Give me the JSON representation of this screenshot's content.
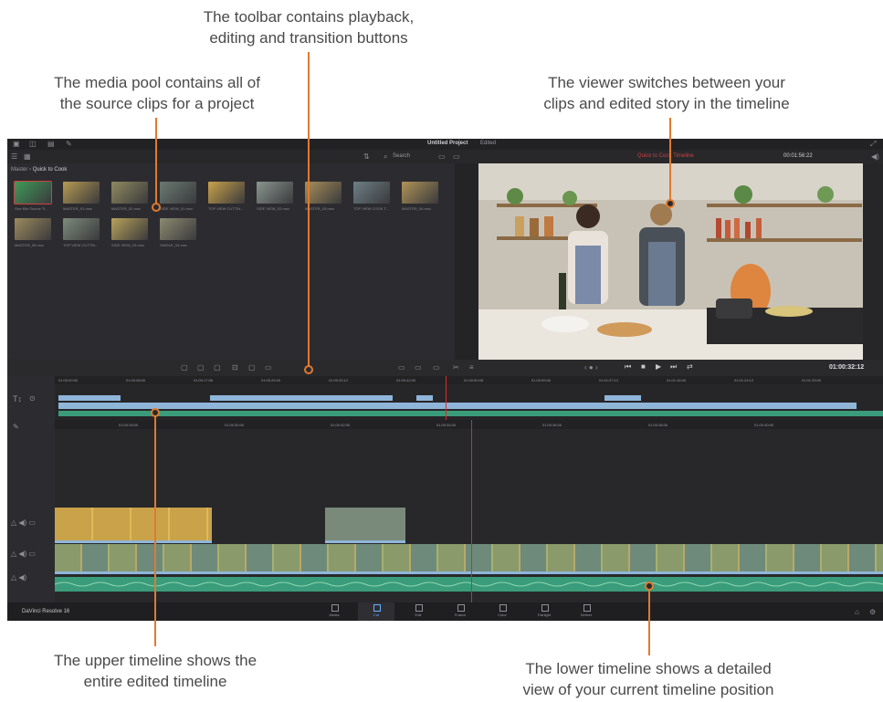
{
  "callouts": {
    "toolbar": [
      "The toolbar contains playback,",
      "editing and transition buttons"
    ],
    "media_pool": [
      "The media pool contains all of",
      "the source clips for a project"
    ],
    "viewer": [
      "The viewer switches between your",
      "clips and edited story in the timeline"
    ],
    "upper_timeline": [
      "The upper timeline shows the",
      "entire edited timeline"
    ],
    "lower_timeline": [
      "The lower timeline shows a detailed",
      "view of your current timeline position"
    ]
  },
  "app": {
    "project_title": "Untitled Project",
    "project_status": "Edited",
    "breadcrumb": [
      "Master",
      "Quick to Cook"
    ],
    "search_placeholder": "Search",
    "viewer_clip_name": "Quick to Cook Timeline",
    "viewer_timecode_top": "00:01:56:22",
    "viewer_timecode": "01:00:32:12",
    "brand": "DaVinci Resolve 16",
    "pages": [
      "Media",
      "Cut",
      "Edit",
      "Fusion",
      "Color",
      "Fairlight",
      "Deliver"
    ],
    "active_page": "Cut"
  },
  "clips": [
    {
      "label": "One Min Source Ti...",
      "color": "#3f9a5a"
    },
    {
      "label": "MASTER_01.mov",
      "color": "#b79a52"
    },
    {
      "label": "MASTER_02.mov",
      "color": "#8f8a60"
    },
    {
      "label": "SIDE VIEW_01.mov",
      "color": "#6a7a72"
    },
    {
      "label": "TOP VIEW CUTTIN...",
      "color": "#c9a24a"
    },
    {
      "label": "SIDE VIEW_02.mov",
      "color": "#8a9690"
    },
    {
      "label": "MASTER_03.mov",
      "color": "#a88f5a"
    },
    {
      "label": "TOP VIEW COOK T...",
      "color": "#6d7f86"
    },
    {
      "label": "MASTER_04.mov",
      "color": "#b09358"
    },
    {
      "label": "MASTER_05.mov",
      "color": "#9c8a5e"
    },
    {
      "label": "TOP VIEW CUTTIN...",
      "color": "#7d8a7a"
    },
    {
      "label": "SIDE VIEW_03.mov",
      "color": "#b8a25a"
    },
    {
      "label": "SINGLE_04.mov",
      "color": "#8c8a70"
    }
  ],
  "timeline": {
    "upper_ruler": [
      "01:00:00:00",
      "01:00:08:00",
      "01:00:17:06",
      "01:00:25:00",
      "01:00:33:12",
      "01:00:42:00",
      "01:00:50:08",
      "01:00:59:00",
      "01:01:07:12",
      "01:01:16:00",
      "01:01:24:12",
      "01:01:33:00"
    ],
    "lower_ruler": [
      "01:00:28:00",
      "01:00:30:00",
      "01:00:32:00",
      "01:00:34:00",
      "01:00:36:00",
      "01:00:38:00",
      "01:00:40:00"
    ]
  },
  "colors": {
    "accent": "#e07a2f",
    "playhead": "#e0282a",
    "video_clip": "#8fb6d9",
    "audio_clip": "#3a9c7a"
  }
}
